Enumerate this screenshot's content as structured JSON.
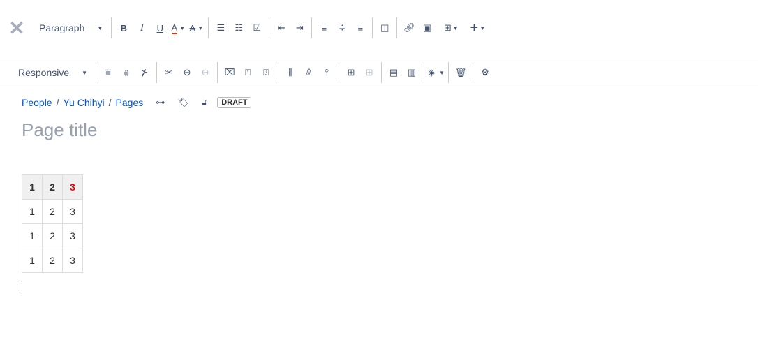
{
  "toolbar": {
    "paragraph": "Paragraph",
    "responsive": "Responsive"
  },
  "breadcrumb": [
    "People",
    "Yu Chihyi",
    "Pages"
  ],
  "separator": "/",
  "draft_label": "DRAFT",
  "title_placeholder": "Page title",
  "table": {
    "header": [
      "1",
      "2",
      "3"
    ],
    "rows": [
      [
        "1",
        "2",
        "3"
      ],
      [
        "1",
        "2",
        "3"
      ],
      [
        "1",
        "2",
        "3"
      ]
    ]
  },
  "colors": {
    "accent": "#0052cc",
    "header_red": "#ff0000"
  }
}
